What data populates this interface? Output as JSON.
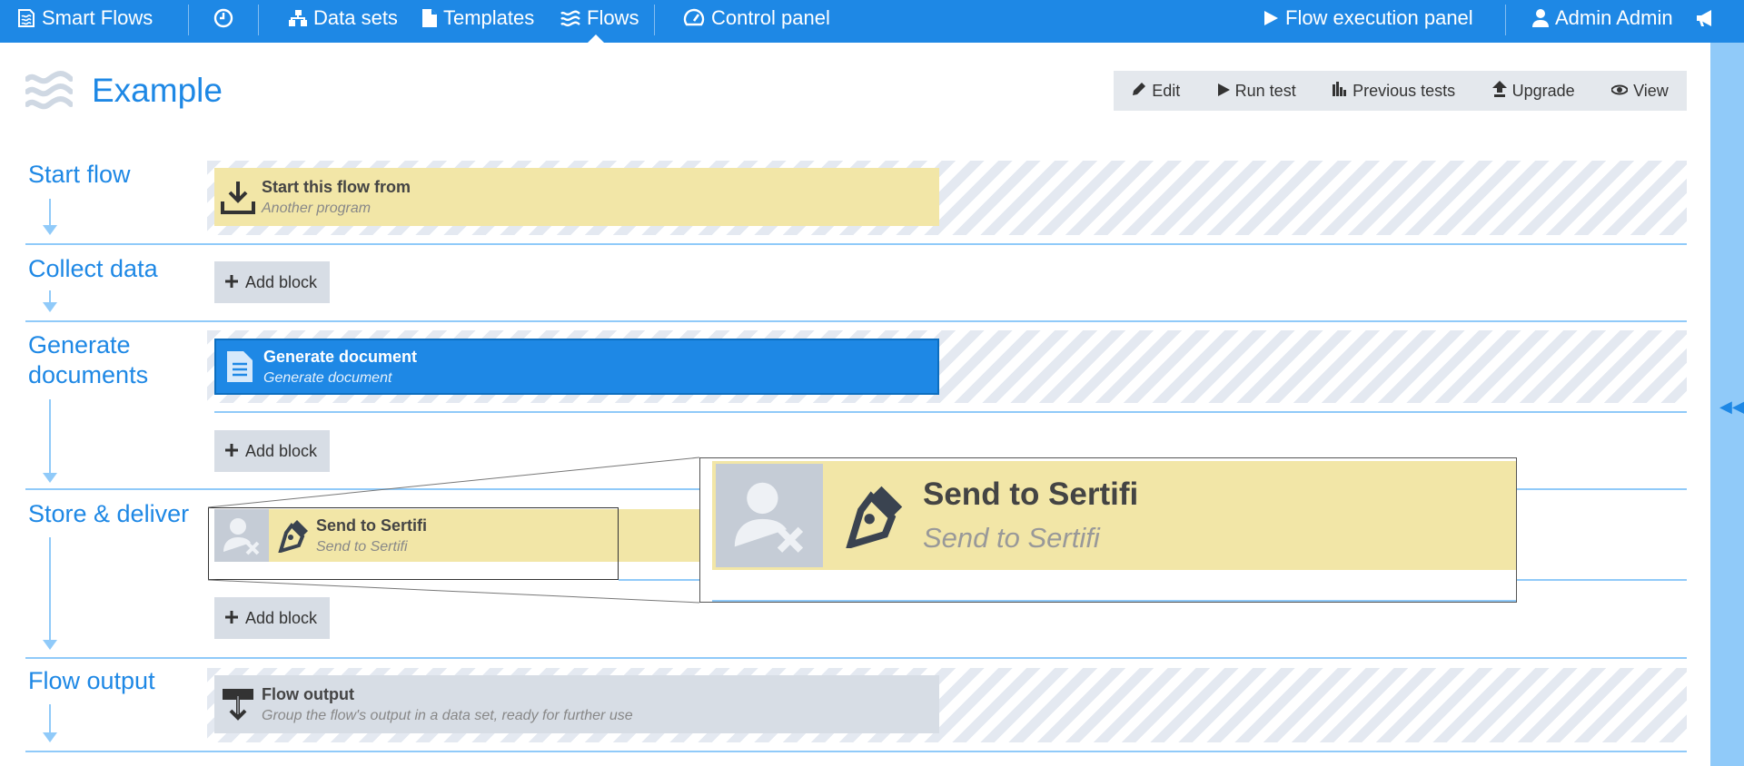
{
  "navbar": {
    "app_name": "Smart Flows",
    "items": [
      {
        "label": "Data sets",
        "icon": "sitemap-icon"
      },
      {
        "label": "Templates",
        "icon": "file-icon"
      },
      {
        "label": "Flows",
        "icon": "waves-icon",
        "active": true
      },
      {
        "label": "Control panel",
        "icon": "dashboard-icon"
      }
    ],
    "right": {
      "execution_panel": "Flow execution panel",
      "user": "Admin Admin"
    }
  },
  "header": {
    "title": "Example",
    "toolbar": {
      "edit": "Edit",
      "run_test": "Run test",
      "previous_tests": "Previous tests",
      "upgrade": "Upgrade",
      "view": "View"
    }
  },
  "stages": {
    "start": {
      "label": "Start flow",
      "block": {
        "title": "Start this flow from",
        "subtitle": "Another program"
      }
    },
    "collect": {
      "label": "Collect data",
      "add": "Add block"
    },
    "generate": {
      "label_line1": "Generate",
      "label_line2": "documents",
      "block": {
        "title": "Generate document",
        "subtitle": "Generate document"
      },
      "add": "Add block"
    },
    "store": {
      "label": "Store & deliver",
      "block": {
        "title": "Send to Sertifi",
        "subtitle": "Send to Sertifi"
      },
      "add": "Add block"
    },
    "output": {
      "label": "Flow output",
      "block": {
        "title": "Flow output",
        "subtitle": "Group the flow's output in a data set, ready for further use"
      }
    }
  },
  "zoom": {
    "title": "Send to Sertifi",
    "subtitle": "Send to Sertifi"
  },
  "colors": {
    "primary": "#1e88e5",
    "light_blue": "#90caf9",
    "yellow_block": "#f2e6a7",
    "grey_block": "#d7dde5"
  }
}
